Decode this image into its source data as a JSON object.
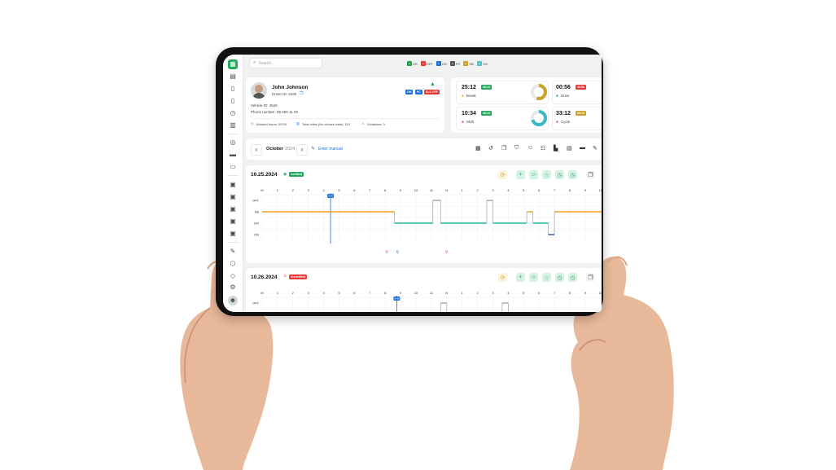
{
  "search": {
    "placeholder": "Search..."
  },
  "legend": [
    {
      "label": "DR",
      "color": "#22a34a"
    },
    {
      "label": "OFF",
      "color": "#e53935"
    },
    {
      "label": "ON",
      "color": "#1e6fd9"
    },
    {
      "label": "PC",
      "color": "#555555"
    },
    {
      "label": "SB",
      "color": "#c9a227"
    },
    {
      "label": "YM",
      "color": "#4cc3c7"
    }
  ],
  "driver": {
    "name": "John Johnson",
    "driver_id": "Driver ID: 2330",
    "vehicle_id": "Vehicle ID: 4545",
    "phone": "Phone number: 99 000 11 00",
    "worked_hours": "Worked hours: 00:00",
    "total_miles": "Total miles (for chosen date): 110",
    "violations": "Violations: 0",
    "status_on": "ON",
    "status_pc": "PC",
    "status_eld": "ELD OFF"
  },
  "timers": [
    {
      "time": "25:12",
      "badge": "05:15",
      "label": "Break",
      "dot": "#e3a21a",
      "ring": "#c9a227",
      "pct": 0.55,
      "badge_color": "#20a85b"
    },
    {
      "time": "00:56",
      "badge": "00:56",
      "label": "Drive",
      "dot": "#22a34a",
      "ring": "#22a34a",
      "pct": 0.1,
      "badge_color": "#e53935"
    },
    {
      "time": "10:34",
      "badge": "05:15",
      "label": "Shift",
      "dot": "#e53935",
      "ring": "#3bb8c4",
      "pct": 0.7,
      "badge_color": "#20a85b"
    },
    {
      "time": "33:12",
      "badge": "05:15",
      "label": "Cycle",
      "dot": "#e53935",
      "ring": "#c9a227",
      "pct": 0.4,
      "badge_color": "#c9a227"
    }
  ],
  "toolbar": {
    "month": "October",
    "year": "2024",
    "enter_manual": "Enter manual",
    "prev": "‹",
    "next": "›"
  },
  "logs": [
    {
      "date": "10.25.2024",
      "status": "Certified",
      "status_color": "#20a85b"
    },
    {
      "date": "10.26.2024",
      "status": "Uncertified",
      "status_color": "#e53935"
    }
  ],
  "hours": [
    "M",
    "1",
    "2",
    "3",
    "4",
    "5",
    "6",
    "7",
    "8",
    "9",
    "10",
    "11",
    "N",
    "1",
    "2",
    "3",
    "4",
    "5",
    "6",
    "7",
    "8",
    "9",
    "10"
  ],
  "statuses": [
    "OFF",
    "SB",
    "DR",
    "ON"
  ],
  "marker1": "4:26",
  "marker2": "8:45",
  "colors": {
    "accent": "#20a85b",
    "sb": "#f0a020",
    "dr": "#22b3a3",
    "off": "#9aa3b2",
    "on": "#2a4fb0",
    "marker": "#1e6fd9"
  }
}
